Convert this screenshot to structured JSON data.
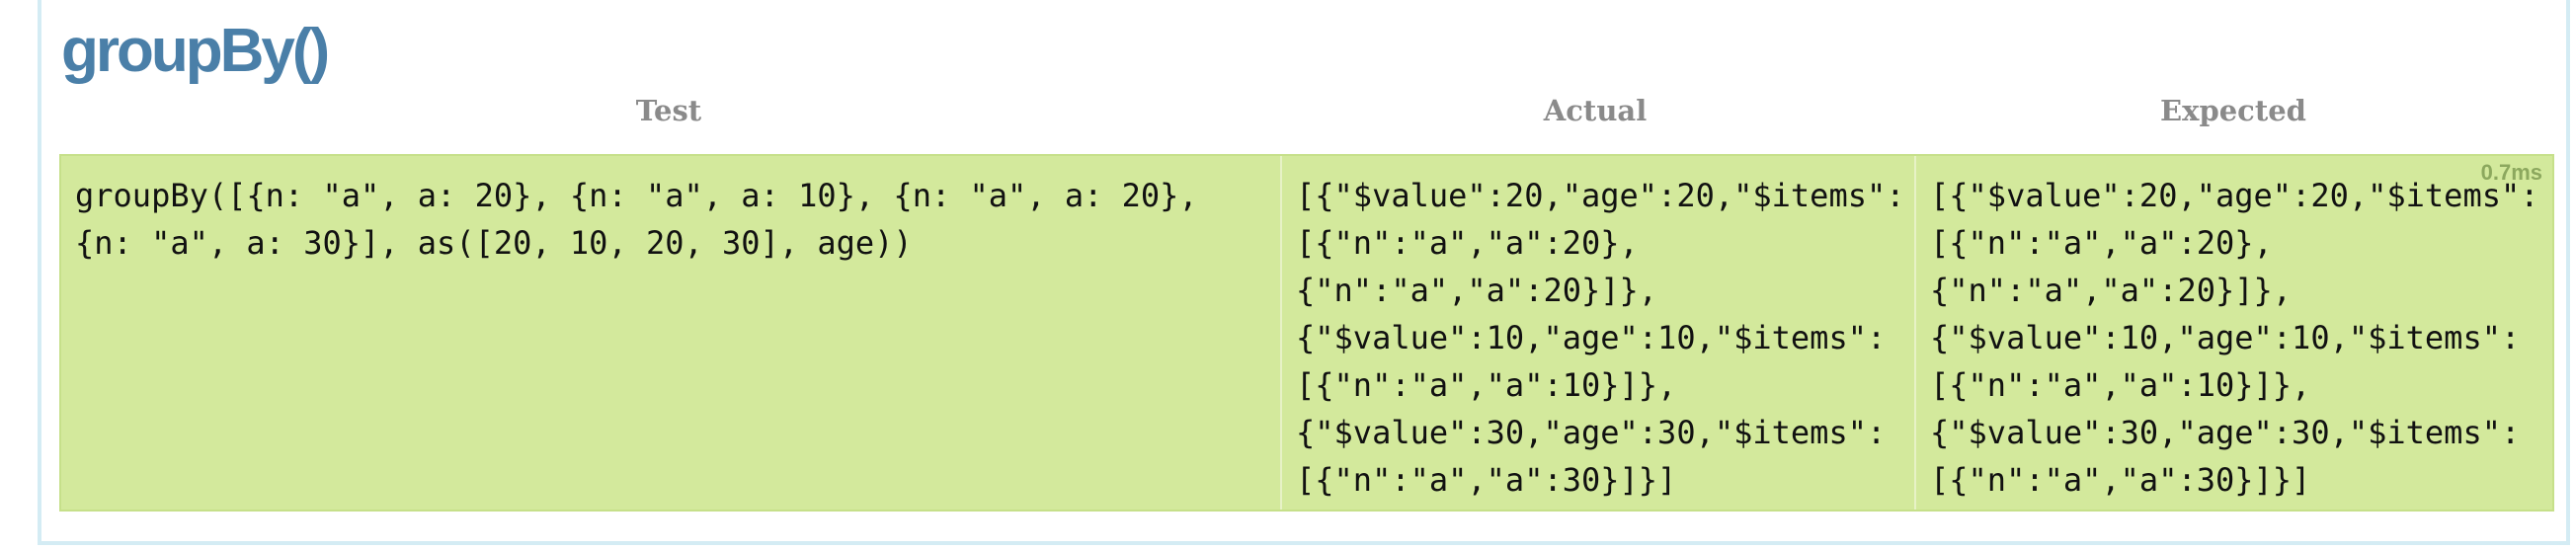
{
  "title": "groupBy()",
  "headers": {
    "test": "Test",
    "actual": "Actual",
    "expected": "Expected"
  },
  "row": {
    "test_lines": [
      "groupBy([{n: \"a\", a: 20}, {n: \"a\", a: 10}, {n: \"a\", a: 20},",
      "{n: \"a\", a: 30}], as([20, 10, 20, 30], age))"
    ],
    "actual_lines": [
      "[{\"$value\":20,\"age\":20,\"$items\":",
      "[{\"n\":\"a\",\"a\":20},",
      "{\"n\":\"a\",\"a\":20}]},",
      "{\"$value\":10,\"age\":10,\"$items\":",
      "[{\"n\":\"a\",\"a\":10}]},",
      "{\"$value\":30,\"age\":30,\"$items\":",
      "[{\"n\":\"a\",\"a\":30}]}]"
    ],
    "expected_lines": [
      "[{\"$value\":20,\"age\":20,\"$items\":",
      "[{\"n\":\"a\",\"a\":20},",
      "{\"n\":\"a\",\"a\":20}]},",
      "{\"$value\":10,\"age\":10,\"$items\":",
      "[{\"n\":\"a\",\"a\":10}]},",
      "{\"$value\":30,\"age\":30,\"$items\":",
      "[{\"n\":\"a\",\"a\":30}]}]"
    ],
    "timing": "0.7ms",
    "status_color": "#d3e99c"
  },
  "colors": {
    "title": "#4a7fa8",
    "header": "#8a8a8a",
    "frame_border": "#d4ecf4",
    "timing": "#8ca85e"
  }
}
